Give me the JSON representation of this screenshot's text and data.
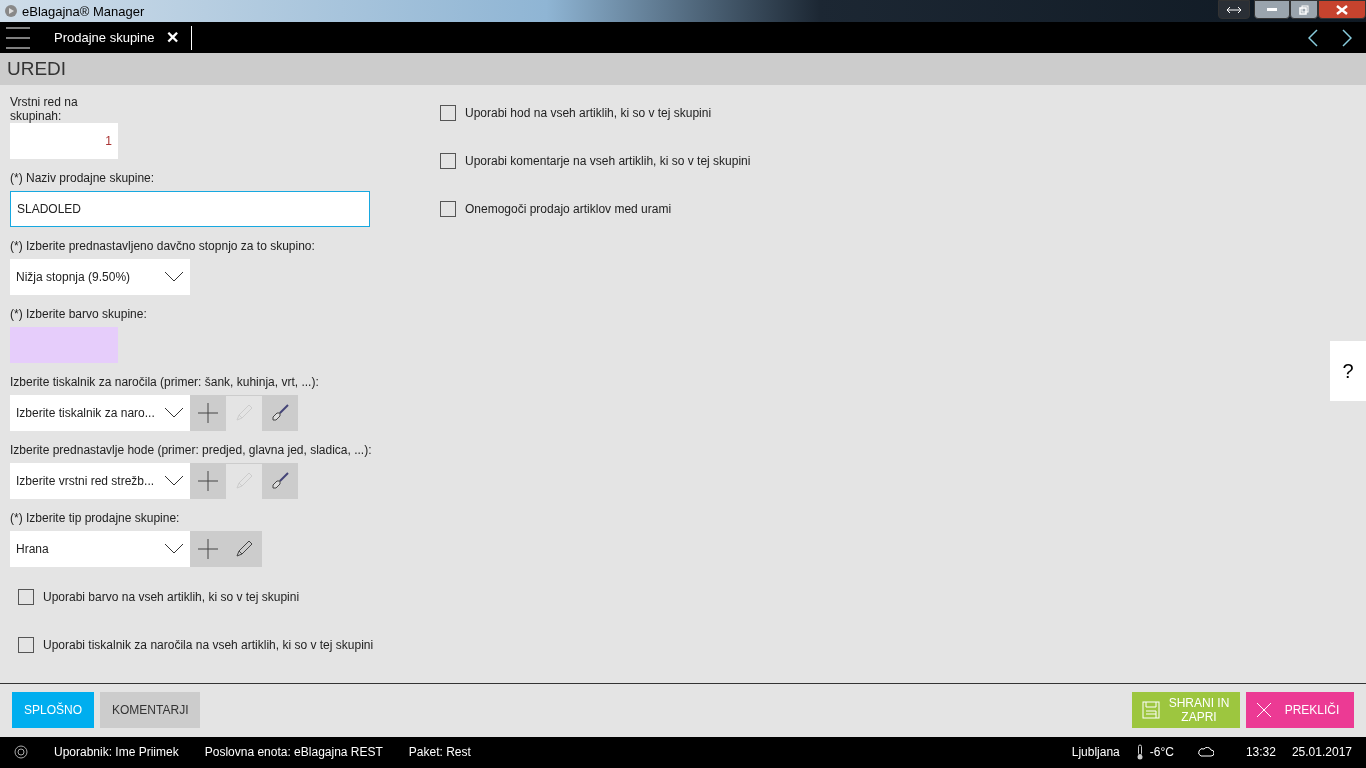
{
  "window": {
    "title": "eBlagajna® Manager"
  },
  "topbar": {
    "tab": "Prodajne skupine",
    "close": "✕"
  },
  "header": {
    "title": "UREDI"
  },
  "form": {
    "order": {
      "label": "Vrstni red na skupinah:",
      "value": "1"
    },
    "name": {
      "label": "(*) Naziv prodajne skupine:",
      "value": "SLADOLED"
    },
    "tax": {
      "label": "(*) Izberite prednastavljeno davčno stopnjo za to skupino:",
      "value": "Nižja stopnja (9.50%)"
    },
    "color": {
      "label": "(*) Izberite barvo skupine:",
      "color": "#e6cdfb"
    },
    "selects": [
      {
        "label": "Izberite tiskalnik za naročila (primer: šank, kuhinja, vrt, ...):",
        "value": "Izberite tiskalnik za naro...",
        "tools": [
          {
            "kind": "add",
            "disabled": false
          },
          {
            "kind": "edit",
            "disabled": true
          },
          {
            "kind": "brush",
            "disabled": false
          }
        ]
      },
      {
        "label": "Izberite prednastavlje hode (primer: predjed, glavna jed, sladica, ...):",
        "value": "Izberite vrstni red strežb...",
        "tools": [
          {
            "kind": "add",
            "disabled": false
          },
          {
            "kind": "edit",
            "disabled": true
          },
          {
            "kind": "brush",
            "disabled": false
          }
        ]
      },
      {
        "label": "(*) Izberite tip prodajne skupine:",
        "value": "Hrana",
        "tools": [
          {
            "kind": "add",
            "disabled": false
          },
          {
            "kind": "edit",
            "disabled": false
          }
        ]
      }
    ],
    "left_checks": [
      {
        "label": "Uporabi barvo na vseh artiklih, ki so v tej skupini",
        "checked": false
      },
      {
        "label": "Uporabi tiskalnik za naročila na vseh artiklih, ki so v tej skupini",
        "checked": false
      }
    ],
    "right_checks": [
      {
        "label": "Uporabi hod na vseh artiklih, ki so v tej skupini",
        "checked": false
      },
      {
        "label": "Uporabi komentarje na vseh artiklih, ki so v tej skupini",
        "checked": false
      },
      {
        "label": "Onemogoči prodajo artiklov med urami",
        "checked": false
      }
    ]
  },
  "help": "?",
  "tabs": [
    {
      "label": "SPLOŠNO",
      "selected": true
    },
    {
      "label": "KOMENTARJI",
      "selected": false
    }
  ],
  "actions": {
    "save": "SHRANI IN ZAPRI",
    "cancel": "PREKLIČI"
  },
  "status_bar": {
    "user": "Uporabnik: Ime Priimek",
    "unit": "Poslovna enota: eBlagajna REST",
    "package": "Paket: Rest",
    "city": "Ljubljana",
    "temp": "-6°C",
    "time": "13:32",
    "date": "25.01.2017"
  }
}
